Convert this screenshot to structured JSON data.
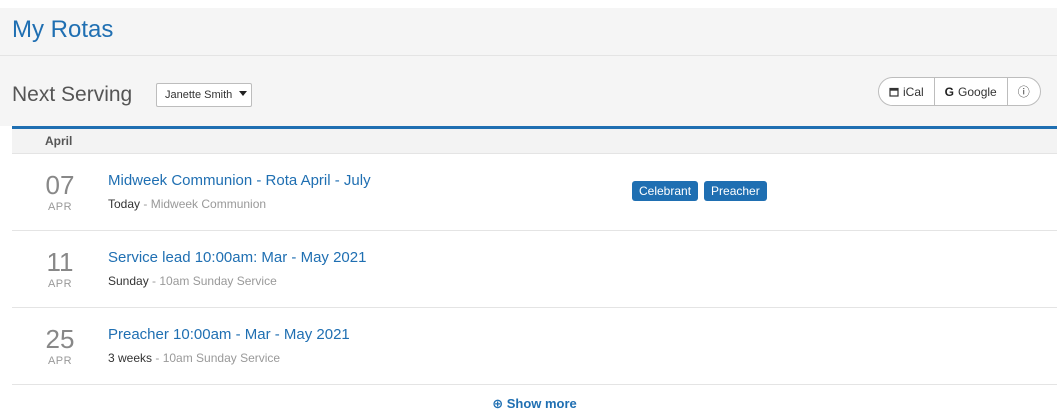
{
  "header": {
    "title": "My Rotas"
  },
  "toolbar": {
    "section_title": "Next Serving",
    "person_select": "Janette Smith",
    "buttons": {
      "ical": "iCal",
      "google_icon": "G",
      "google": "Google",
      "info_icon": "ⓘ"
    }
  },
  "month": "April",
  "items": [
    {
      "day": "07",
      "month": "APR",
      "title": "Midweek Communion - Rota April - July",
      "when": "Today",
      "service": " - Midweek Communion",
      "badges": [
        "Celebrant",
        "Preacher"
      ]
    },
    {
      "day": "11",
      "month": "APR",
      "title": "Service lead 10:00am: Mar - May 2021",
      "when": "Sunday",
      "service": " - 10am Sunday Service",
      "badges": []
    },
    {
      "day": "25",
      "month": "APR",
      "title": "Preacher 10:00am - Mar - May 2021",
      "when": "3 weeks",
      "service": " - 10am Sunday Service",
      "badges": []
    }
  ],
  "show_more": {
    "icon": "⊕",
    "label": "Show more"
  },
  "colors": {
    "accent": "#1f6fb2",
    "background": "#f5f5f5"
  }
}
